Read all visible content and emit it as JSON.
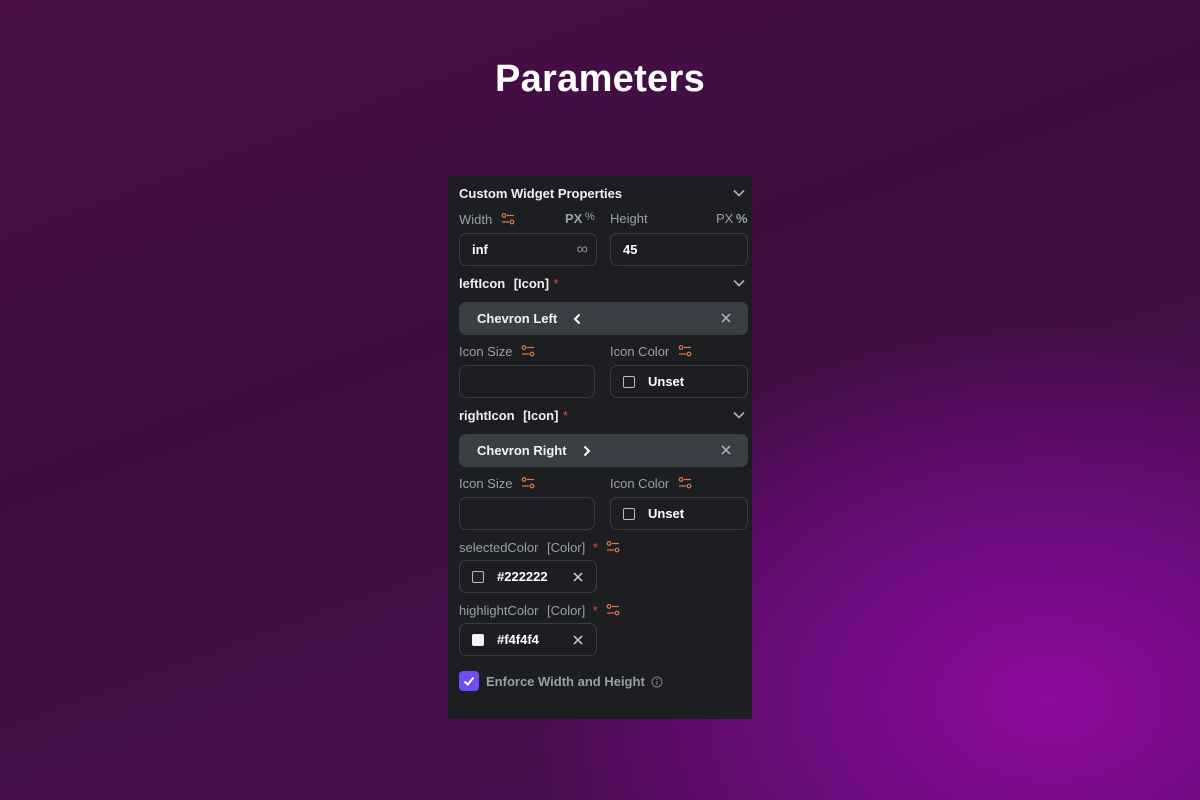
{
  "page": {
    "title": "Parameters"
  },
  "panel": {
    "section_title": "Custom Widget Properties",
    "width": {
      "label": "Width",
      "unit_px": "PX",
      "unit_pct": "%",
      "value": "inf"
    },
    "height": {
      "label": "Height",
      "unit_px": "PX",
      "unit_pct": "%",
      "value": "45"
    },
    "left_icon": {
      "name": "leftIcon",
      "type": "[Icon]",
      "required_mark": "*",
      "chip_label": "Chevron Left",
      "icon_size_label": "Icon Size",
      "icon_color_label": "Icon Color",
      "icon_color_value": "Unset"
    },
    "right_icon": {
      "name": "rightIcon",
      "type": "[Icon]",
      "required_mark": "*",
      "chip_label": "Chevron Right",
      "icon_size_label": "Icon Size",
      "icon_color_label": "Icon Color",
      "icon_color_value": "Unset"
    },
    "selected_color": {
      "name": "selectedColor",
      "type": "[Color]",
      "required_mark": "*",
      "value": "#222222"
    },
    "highlight_color": {
      "name": "highlightColor",
      "type": "[Color]",
      "required_mark": "*",
      "value": "#f4f4f4"
    },
    "enforce": {
      "label": "Enforce Width and Height",
      "checked": true
    }
  },
  "colors": {
    "accent": "#6c4ef2",
    "panel_bg": "#1c1e21",
    "chip_bg": "#3a3e45",
    "tune_icon": "#e0794a",
    "required": "#e5484d"
  }
}
